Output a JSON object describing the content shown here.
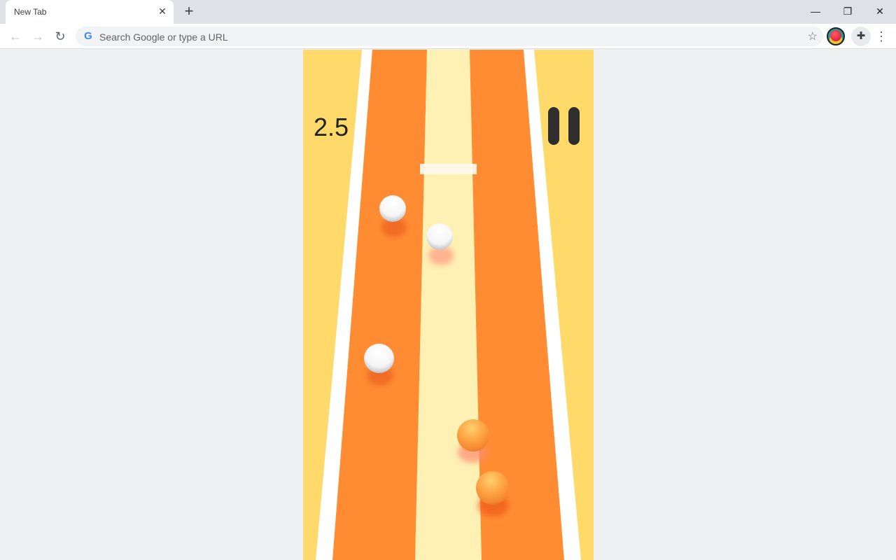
{
  "browser": {
    "tab_title": "New Tab",
    "tab_close_glyph": "✕",
    "new_tab_glyph": "+",
    "window_controls": {
      "minimize": "—",
      "restore": "❐",
      "close": "✕"
    },
    "nav": {
      "back": "←",
      "forward": "→",
      "reload": "↻"
    },
    "omnibox_placeholder": "Search Google or type a URL",
    "google_glyph": "G",
    "bookmark_glyph": "☆",
    "extensions_glyph": "✚",
    "menu_glyph": "⋮"
  },
  "game": {
    "score": "2.5",
    "colors": {
      "background": "#ffda6b",
      "edge": "#ffffff",
      "lane": "#ff8c33",
      "center": "#fff0b3",
      "hud_text": "#222222"
    },
    "balls": [
      {
        "kind": "white",
        "lane": "left"
      },
      {
        "kind": "white",
        "lane": "center"
      },
      {
        "kind": "white",
        "lane": "left"
      },
      {
        "kind": "orange",
        "lane": "center-right"
      },
      {
        "kind": "orange",
        "lane": "right"
      }
    ]
  }
}
